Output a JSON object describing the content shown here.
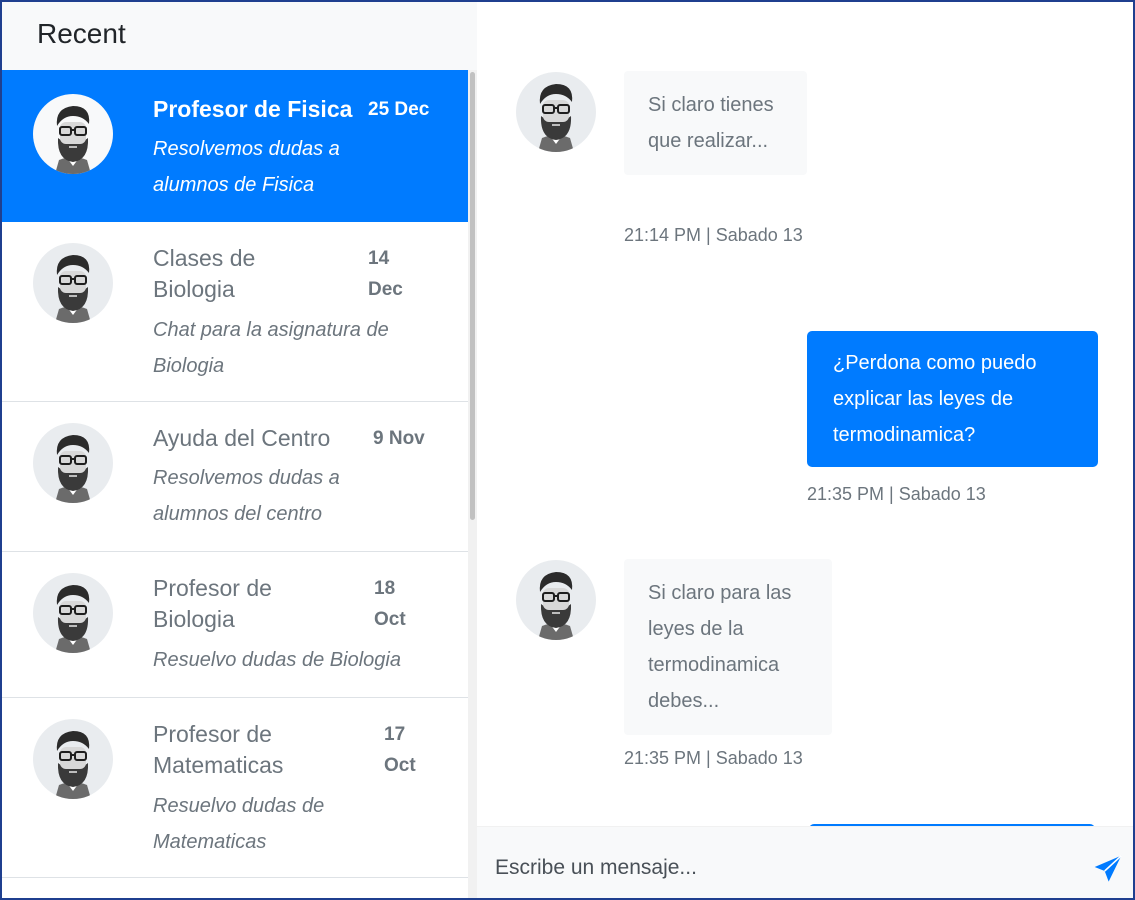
{
  "sidebar": {
    "title": "Recent",
    "chats": [
      {
        "name": "Profesor de Fisica",
        "date": "25 Dec",
        "description": "Resolvemos dudas a alumnos de Fisica",
        "active": true
      },
      {
        "name": "Clases de Biologia",
        "date": "14 Dec",
        "description": "Chat para la asignatura de Biologia",
        "active": false
      },
      {
        "name": "Ayuda del Centro",
        "date": "9 Nov",
        "description": "Resolvemos dudas a alumnos del centro",
        "active": false
      },
      {
        "name": "Profesor de Biologia",
        "date": "18 Oct",
        "description": "Resuelvo dudas de Biologia",
        "active": false
      },
      {
        "name": "Profesor de Matematicas",
        "date": "17 Oct",
        "description": "Resuelvo dudas de Matematicas",
        "active": false
      }
    ]
  },
  "conversation": {
    "messages": [
      {
        "direction": "incoming",
        "text": "Si claro tienes que realizar...",
        "time": "21:14 PM | Sabado 13"
      },
      {
        "direction": "outgoing",
        "text": "¿Perdona como puedo explicar las leyes de termodinamica?",
        "time": "21:35 PM | Sabado 13"
      },
      {
        "direction": "incoming",
        "text": "Si claro para las leyes de la termodinamica debes...",
        "time": "21:35 PM | Sabado 13"
      }
    ]
  },
  "composer": {
    "placeholder": "Escribe un mensaje..."
  },
  "colors": {
    "accent": "#007bff",
    "incoming_bubble": "#f8f9fa",
    "muted_text": "#6c757d",
    "frame_border": "#1f3f8f"
  },
  "icons": {
    "avatar": "user-avatar-icon",
    "send": "paper-plane-icon"
  }
}
